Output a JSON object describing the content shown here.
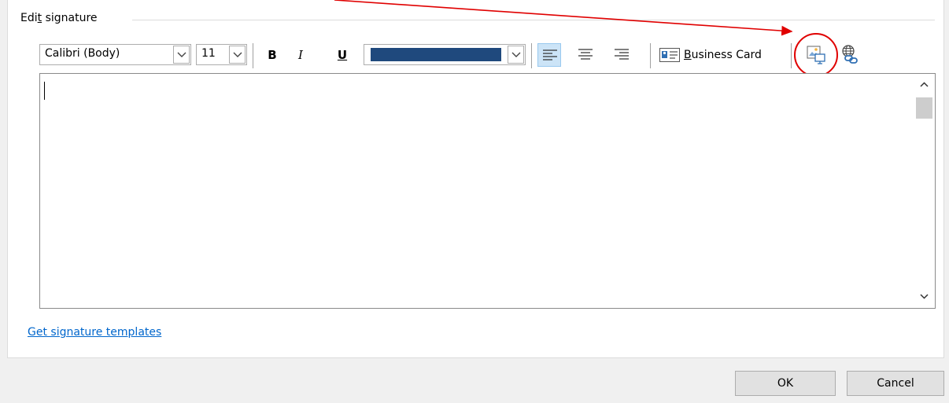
{
  "dialog": {
    "group_title_pre": "Edi",
    "group_title_key": "t",
    "group_title_post": " signature"
  },
  "toolbar": {
    "font_family": "Calibri (Body)",
    "font_size": "11",
    "bold_label": "B",
    "italic_label": "I",
    "underline_label": "U",
    "font_color": "#1f497d",
    "business_card_key": "B",
    "business_card_rest": "usiness Card"
  },
  "editor": {
    "content": ""
  },
  "links": {
    "templates": "Get signature templates"
  },
  "buttons": {
    "ok": "OK",
    "cancel": "Cancel"
  },
  "colors": {
    "annotation": "#e00000",
    "link": "#0066cc",
    "active_align": "#cce4f7"
  }
}
